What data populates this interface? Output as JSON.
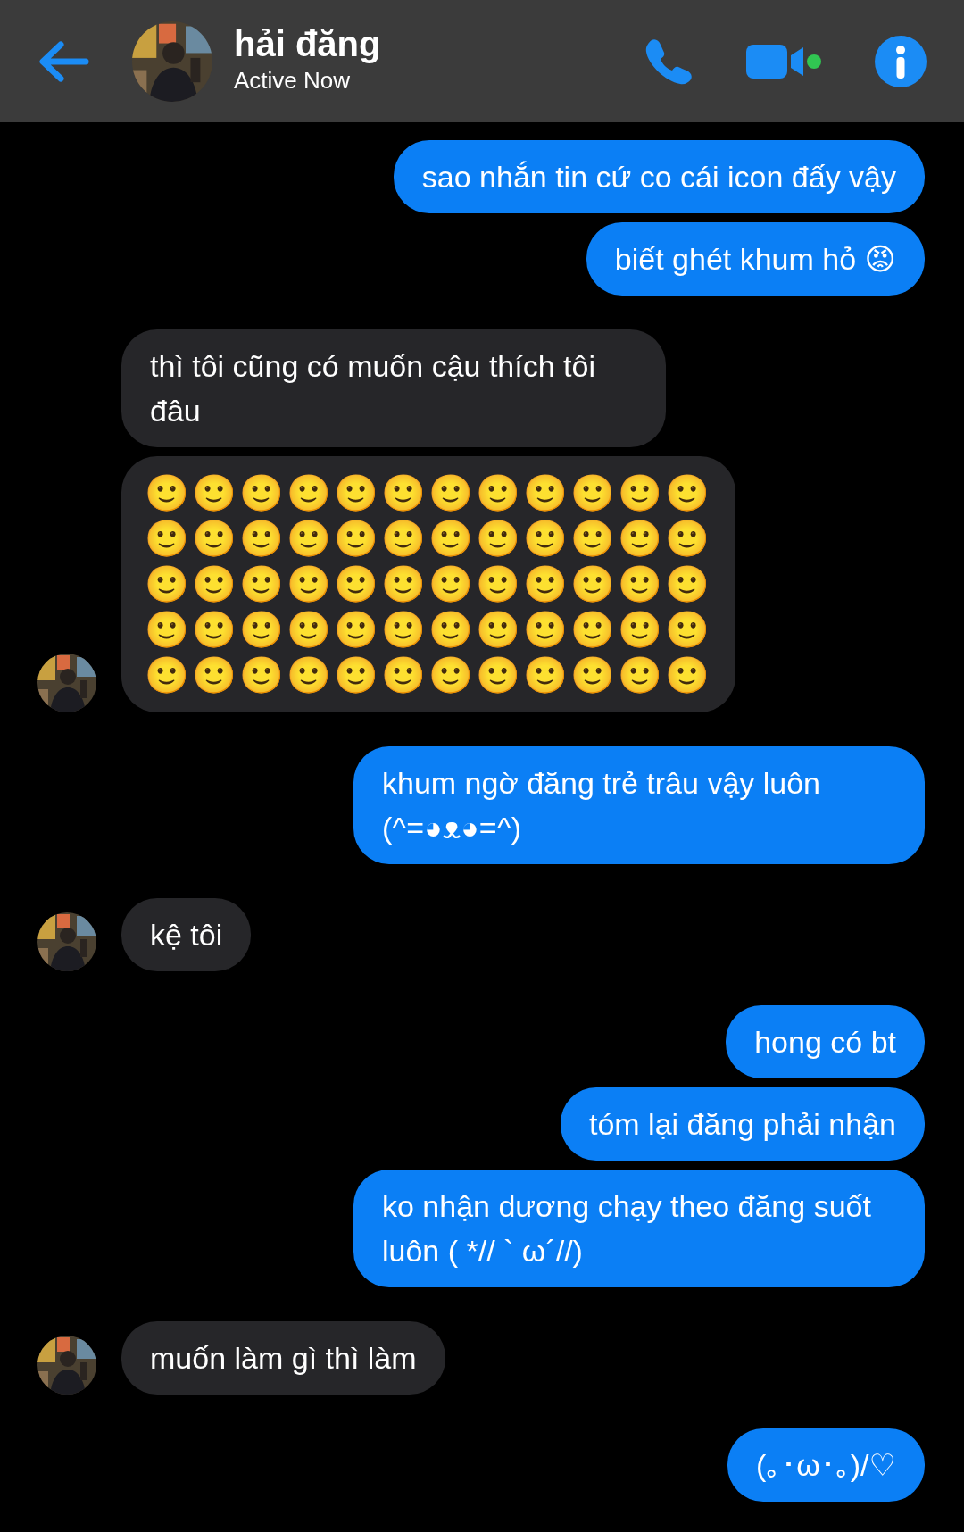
{
  "header": {
    "name": "hải đăng",
    "status": "Active Now",
    "online": true
  },
  "messages": [
    {
      "outgoing": true,
      "kind": "text",
      "text": "sao nhắn tin cứ co cái icon đấy vậy"
    },
    {
      "outgoing": true,
      "kind": "text",
      "text": "biết ghét khum hỏ 😡"
    },
    {
      "outgoing": false,
      "kind": "text",
      "text": "thì tôi cũng có muốn cậu thích tôi đâu"
    },
    {
      "outgoing": false,
      "kind": "emoji_grid",
      "avatar": true,
      "rows": [
        "🙂🙂🙂🙂🙂🙂🙂🙂🙂🙂🙂🙂",
        "🙂🙂🙂🙂🙂🙂🙂🙂🙂🙂🙂🙂",
        "🙂🙂🙂🙂🙂🙂🙂🙂🙂🙂🙂🙂",
        "🙂🙂🙂🙂🙂🙂🙂🙂🙂🙂🙂🙂",
        "🙂🙂🙂🙂🙂🙂🙂🙂🙂🙂🙂🙂"
      ]
    },
    {
      "outgoing": true,
      "kind": "text",
      "text": "khum ngờ đăng trẻ trâu vậy luôn (^=◕ᴥ◕=^)"
    },
    {
      "outgoing": false,
      "kind": "text",
      "avatar": true,
      "text": "kệ tôi"
    },
    {
      "outgoing": true,
      "kind": "text",
      "text": "hong có bt"
    },
    {
      "outgoing": true,
      "kind": "text",
      "text": "tóm lại đăng phải nhận"
    },
    {
      "outgoing": true,
      "kind": "text",
      "text": "ko nhận dương chạy theo đăng suốt luôn ( *// ` ω´//)"
    },
    {
      "outgoing": false,
      "kind": "text",
      "avatar": true,
      "text": "muốn làm gì thì làm"
    },
    {
      "outgoing": true,
      "kind": "text",
      "text": "(｡･ω･｡)/♡"
    }
  ]
}
